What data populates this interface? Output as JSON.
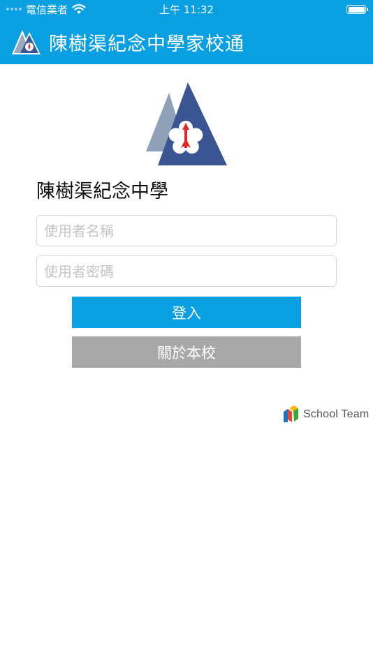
{
  "status_bar": {
    "carrier": "電信業者",
    "time": "上午 11:32"
  },
  "navbar": {
    "title": "陳樹渠紀念中學家校通",
    "logo_icon": "school-mountain-flower-logo"
  },
  "login": {
    "school_name": "陳樹渠紀念中學",
    "username_placeholder": "使用者名稱",
    "password_placeholder": "使用者密碼",
    "login_label": "登入",
    "about_label": "關於本校"
  },
  "branding": {
    "name": "School Team"
  },
  "colors": {
    "primary": "#09a0e3",
    "secondary_button": "#a8a8a8",
    "logo_dark": "#3a5591",
    "logo_light": "#8fa0b9",
    "logo_accent": "#e3262b"
  }
}
